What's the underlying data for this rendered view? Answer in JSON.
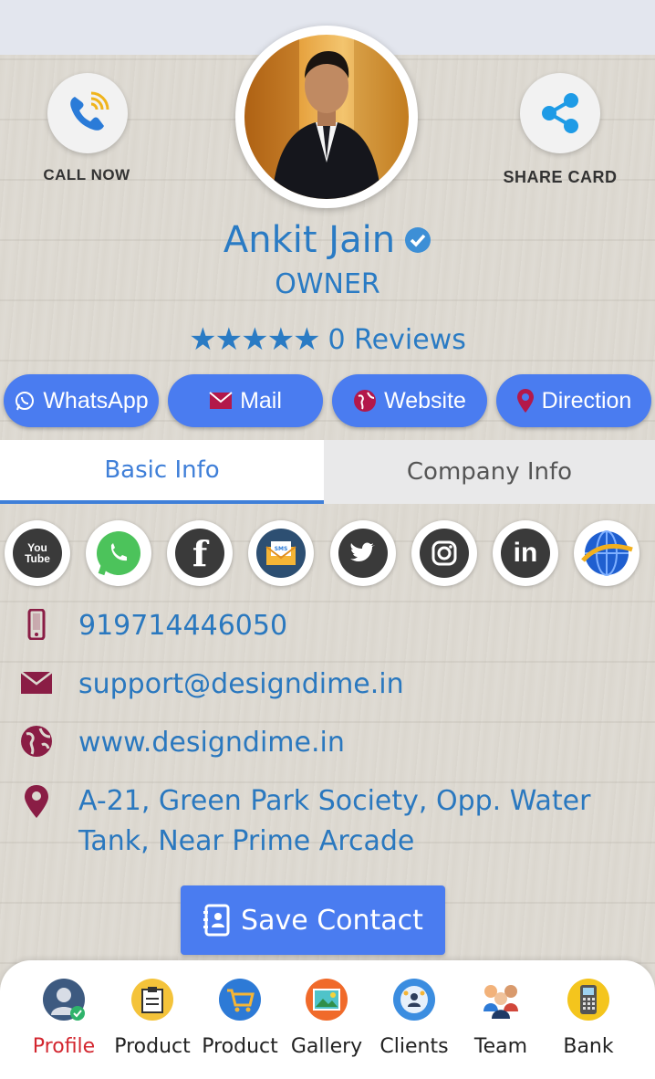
{
  "actions": {
    "call_label": "CALL NOW",
    "share_label": "SHARE CARD"
  },
  "profile": {
    "name": "Ankit Jain",
    "title": "OWNER",
    "rating_stars": 5,
    "reviews_label": "0 Reviews"
  },
  "quick_buttons": [
    {
      "label": "WhatsApp",
      "icon": "whatsapp-icon"
    },
    {
      "label": "Mail",
      "icon": "mail-icon"
    },
    {
      "label": "Website",
      "icon": "globe-icon"
    },
    {
      "label": "Direction",
      "icon": "map-pin-icon"
    }
  ],
  "tabs": {
    "basic": "Basic Info",
    "company": "Company Info",
    "active": "basic"
  },
  "social": {
    "youtube_text": "You Tube",
    "sms_text": "SMS"
  },
  "contact": {
    "phone": "919714446050",
    "email": "support@designdime.in",
    "website": "www.designdime.in",
    "address": "A-21, Green Park Society, Opp. Water Tank, Near Prime Arcade"
  },
  "save_button": "Save Contact",
  "bottom_nav": [
    {
      "label": "Profile",
      "icon": "profile-icon",
      "active": true
    },
    {
      "label": "Product",
      "icon": "product-clipboard-icon"
    },
    {
      "label": "Product",
      "icon": "product-cart-icon"
    },
    {
      "label": "Gallery",
      "icon": "gallery-icon"
    },
    {
      "label": "Clients",
      "icon": "clients-icon"
    },
    {
      "label": "Team",
      "icon": "team-icon"
    },
    {
      "label": "Bank",
      "icon": "bank-icon"
    }
  ],
  "colors": {
    "accent_blue": "#4a7cf0",
    "text_blue": "#2a7bc4",
    "icon_maroon": "#8a1d45",
    "active_nav": "#d3262f"
  }
}
